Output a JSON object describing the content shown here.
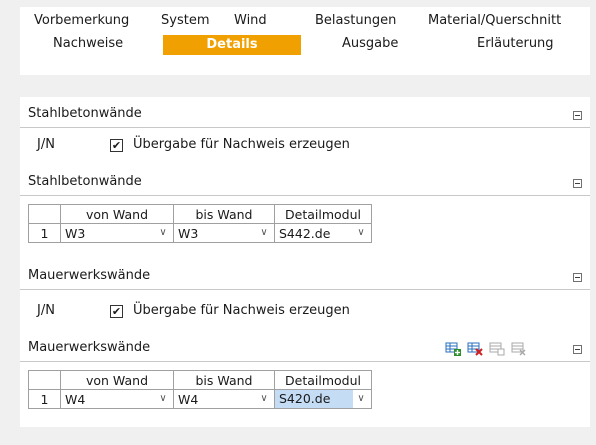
{
  "tabs": [
    {
      "label": "Vorbemerkung"
    },
    {
      "label": "System"
    },
    {
      "label": "Wind"
    },
    {
      "label": "Belastungen"
    },
    {
      "label": "Material/Querschnitt"
    },
    {
      "label": "Nachweise"
    },
    {
      "label": "Details"
    },
    {
      "label": "Ausgabe"
    },
    {
      "label": "Erläuterung"
    }
  ],
  "active_tab": "Details",
  "colors": {
    "active_tab": "#f0a000",
    "selection": "#c5dcf5"
  },
  "sections": {
    "stb_opt": {
      "title": "Stahlbetonwände",
      "row_label": "J/N",
      "checkbox_label": "Übergabe für Nachweis erzeugen",
      "checked": true,
      "check_mark": "✔"
    },
    "stb_table": {
      "title": "Stahlbetonwände",
      "headers": [
        "von Wand",
        "bis Wand",
        "Detailmodul"
      ],
      "rows": [
        {
          "idx": "1",
          "from": "W3",
          "to": "W3",
          "module": "S442.de"
        }
      ]
    },
    "mw_opt": {
      "title": "Mauerwerkswände",
      "row_label": "J/N",
      "checkbox_label": "Übergabe für Nachweis erzeugen",
      "checked": true,
      "check_mark": "✔"
    },
    "mw_table": {
      "title": "Mauerwerkswände",
      "toolbar_icons": [
        "insert-row-icon",
        "delete-row-icon",
        "copy-row-icon",
        "clear-row-icon"
      ],
      "headers": [
        "von Wand",
        "bis Wand",
        "Detailmodul"
      ],
      "rows": [
        {
          "idx": "1",
          "from": "W4",
          "to": "W4",
          "module": "S420.de"
        }
      ]
    }
  }
}
